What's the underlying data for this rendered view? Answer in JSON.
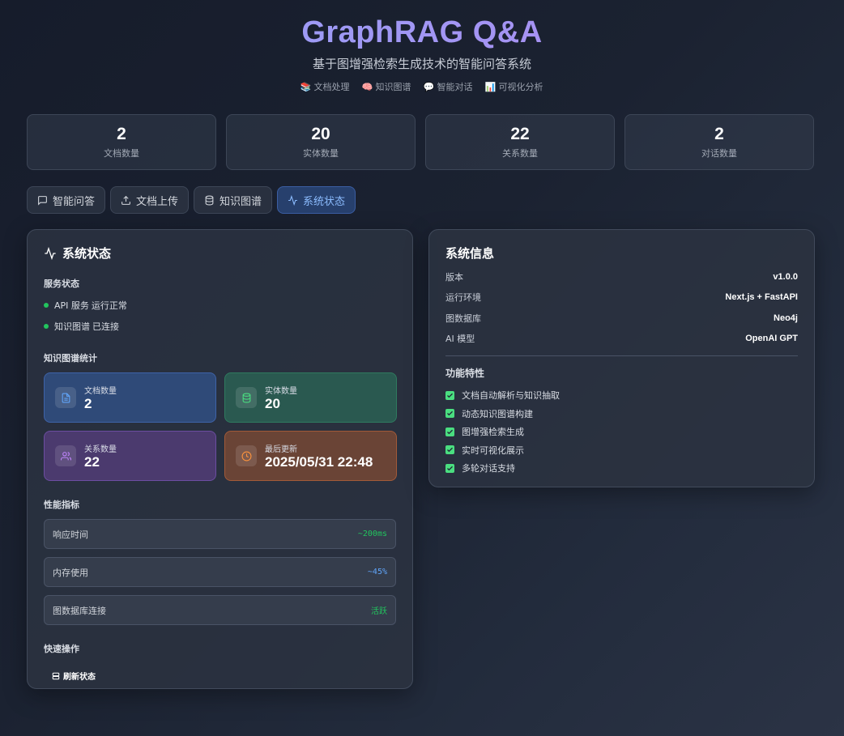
{
  "header": {
    "title": "GraphRAG Q&A",
    "subtitle": "基于图增强检索生成技术的智能问答系统",
    "features": [
      {
        "icon": "📚",
        "label": "文档处理"
      },
      {
        "icon": "🧠",
        "label": "知识图谱"
      },
      {
        "icon": "💬",
        "label": "智能对话"
      },
      {
        "icon": "📊",
        "label": "可视化分析"
      }
    ]
  },
  "stats": [
    {
      "value": "2",
      "label": "文档数量"
    },
    {
      "value": "20",
      "label": "实体数量"
    },
    {
      "value": "22",
      "label": "关系数量"
    },
    {
      "value": "2",
      "label": "对话数量"
    }
  ],
  "tabs": [
    {
      "label": "智能问答",
      "icon": "chat-icon"
    },
    {
      "label": "文档上传",
      "icon": "upload-icon"
    },
    {
      "label": "知识图谱",
      "icon": "database-icon"
    },
    {
      "label": "系统状态",
      "icon": "activity-icon",
      "active": true
    }
  ],
  "status": {
    "title": "系统状态",
    "services_label": "服务状态",
    "services": [
      {
        "name": "API 服务",
        "state": "运行正常"
      },
      {
        "name": "知识图谱",
        "state": "已连接"
      }
    ],
    "kg_label": "知识图谱统计",
    "kg_cards": [
      {
        "label": "文档数量",
        "value": "2",
        "color": "#60a5fa"
      },
      {
        "label": "实体数量",
        "value": "20",
        "color": "#4ade80"
      },
      {
        "label": "关系数量",
        "value": "22",
        "color": "#c084fc"
      },
      {
        "label": "最后更新",
        "value": "2025/05/31 22:48",
        "color": "#fb923c"
      }
    ],
    "perf_label": "性能指标",
    "perf": [
      {
        "label": "响应时间",
        "value": "~200ms",
        "color": "#22c55e"
      },
      {
        "label": "内存使用",
        "value": "~45%",
        "color": "#60a5fa"
      },
      {
        "label": "图数据库连接",
        "value": "活跃",
        "color": "#22c55e"
      }
    ],
    "quick_label": "快速操作",
    "refresh_label": "刷新状态"
  },
  "sysinfo": {
    "title": "系统信息",
    "rows": [
      {
        "label": "版本",
        "value": "v1.0.0"
      },
      {
        "label": "运行环境",
        "value": "Next.js + FastAPI"
      },
      {
        "label": "图数据库",
        "value": "Neo4j"
      },
      {
        "label": "AI 模型",
        "value": "OpenAI GPT"
      }
    ],
    "features_label": "功能特性",
    "features": [
      "文档自动解析与知识抽取",
      "动态知识图谱构建",
      "图增强检索生成",
      "实时可视化展示",
      "多轮对话支持"
    ]
  }
}
